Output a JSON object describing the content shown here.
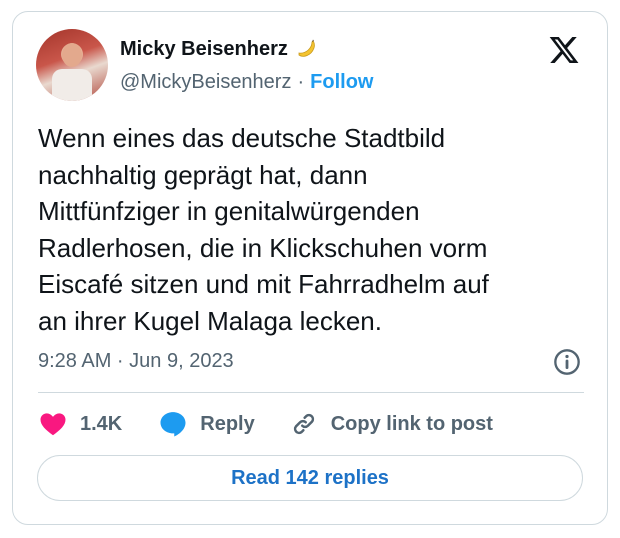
{
  "author": {
    "name": "Micky Beisenherz",
    "handle": "@MickyBeisenherz",
    "separator": "·",
    "follow_label": "Follow",
    "emoji_icon": "banana-icon"
  },
  "tweet": {
    "text": "Wenn eines das deutsche Stadtbild\nnachhaltig geprägt hat, dann\nMittfünfziger in genitalwürgenden\nRadlerhosen, die in Klickschuhen vorm\nEiscafé sitzen und mit Fahrradhelm auf\nan ihrer Kugel Malaga lecken.",
    "timestamp": "9:28 AM · Jun 9, 2023"
  },
  "actions": {
    "likes_count": "1.4K",
    "reply_label": "Reply",
    "copy_link_label": "Copy link to post"
  },
  "read_replies_label": "Read 142 replies",
  "colors": {
    "accent": "#1d9bf0",
    "like": "#f91880",
    "text": "#0f1419",
    "muted": "#536471",
    "border": "#cfd9de"
  }
}
